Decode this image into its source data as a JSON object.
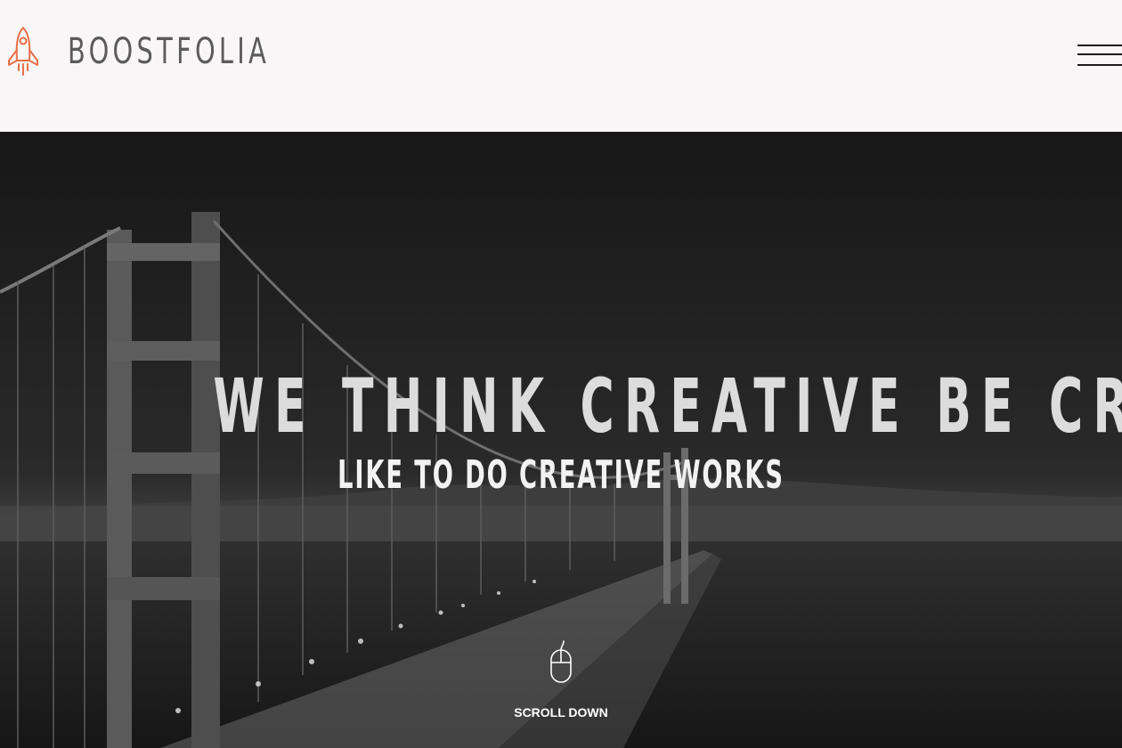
{
  "header": {
    "logo_text": "BOOSTFOLIA",
    "logo_icon": "rocket-icon",
    "menu_icon": "hamburger-menu-icon"
  },
  "hero": {
    "title": "WE THINK CREATIVE BE CREATIVE",
    "subtitle": "LIKE TO DO CREATIVE WORKS",
    "scroll_label": "SCROLL DOWN",
    "scroll_icon": "mouse-icon",
    "background": "night-bridge-photo"
  },
  "colors": {
    "accent": "#e8704a",
    "header_bg": "#f8f6f6",
    "logo_text": "#5b5b5b",
    "hero_text": "#dcdcdc"
  }
}
